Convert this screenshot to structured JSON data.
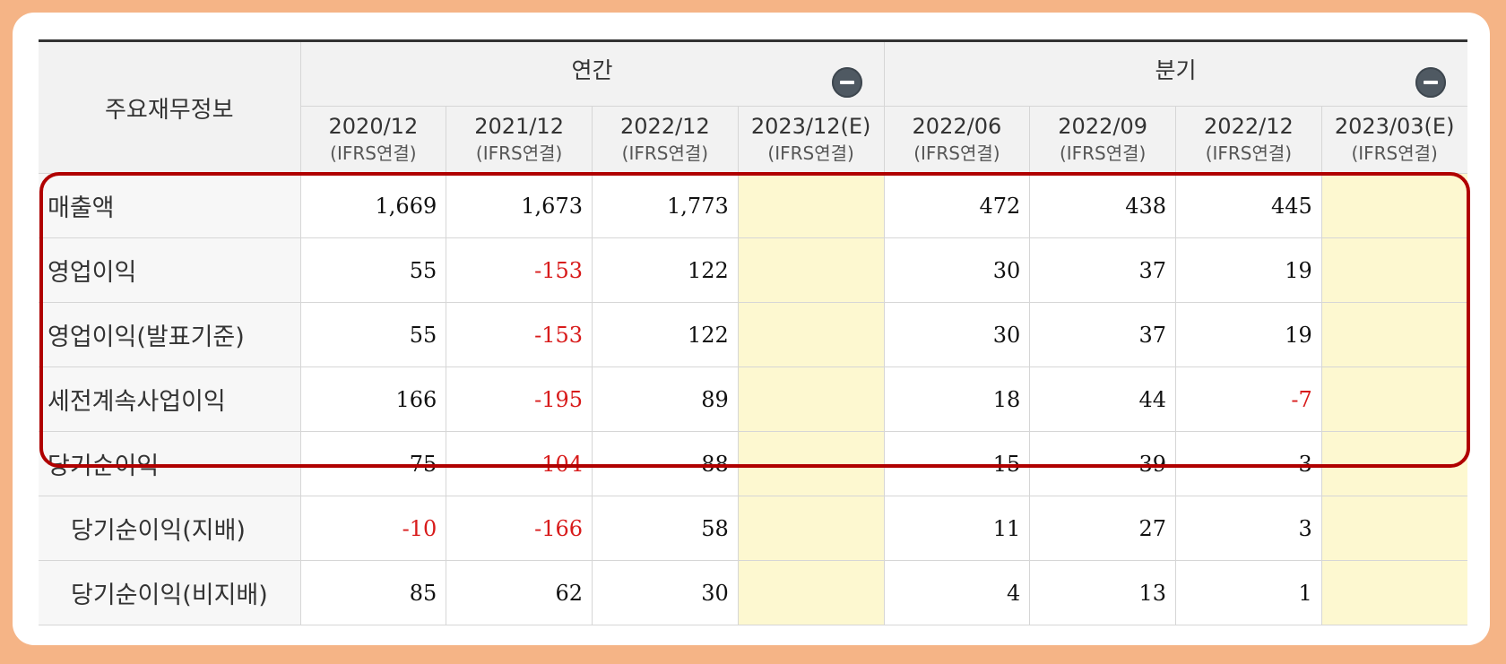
{
  "header": {
    "corner_label": "주요재무정보",
    "groups": [
      {
        "label": "연간",
        "toggle_icon": "minus-circle-icon"
      },
      {
        "label": "분기",
        "toggle_icon": "minus-circle-icon"
      }
    ],
    "periods": [
      {
        "date": "2020/12",
        "type": "(IFRS연결)"
      },
      {
        "date": "2021/12",
        "type": "(IFRS연결)"
      },
      {
        "date": "2022/12",
        "type": "(IFRS연결)"
      },
      {
        "date": "2023/12(E)",
        "type": "(IFRS연결)"
      },
      {
        "date": "2022/06",
        "type": "(IFRS연결)"
      },
      {
        "date": "2022/09",
        "type": "(IFRS연결)"
      },
      {
        "date": "2022/12",
        "type": "(IFRS연결)"
      },
      {
        "date": "2023/03(E)",
        "type": "(IFRS연결)"
      }
    ]
  },
  "rows": [
    {
      "label": "매출액",
      "values": [
        "1,669",
        "1,673",
        "1,773",
        "",
        "472",
        "438",
        "445",
        ""
      ]
    },
    {
      "label": "영업이익",
      "values": [
        "55",
        "-153",
        "122",
        "",
        "30",
        "37",
        "19",
        ""
      ]
    },
    {
      "label": "영업이익(발표기준)",
      "values": [
        "55",
        "-153",
        "122",
        "",
        "30",
        "37",
        "19",
        ""
      ]
    },
    {
      "label": "세전계속사업이익",
      "values": [
        "166",
        "-195",
        "89",
        "",
        "18",
        "44",
        "-7",
        ""
      ]
    },
    {
      "label": "당기순이익",
      "values": [
        "75",
        "-104",
        "88",
        "",
        "15",
        "39",
        "3",
        ""
      ]
    },
    {
      "label": "당기순이익(지배)",
      "values": [
        "-10",
        "-166",
        "58",
        "",
        "11",
        "27",
        "3",
        ""
      ]
    },
    {
      "label": "당기순이익(비지배)",
      "values": [
        "85",
        "62",
        "30",
        "",
        "4",
        "13",
        "1",
        ""
      ]
    }
  ],
  "colors": {
    "frame": "#f5b486",
    "highlight_border": "#b00000",
    "negative": "#d81b1b",
    "estimate_cell": "#fdf8d0",
    "header_bg": "#f2f2f2"
  }
}
